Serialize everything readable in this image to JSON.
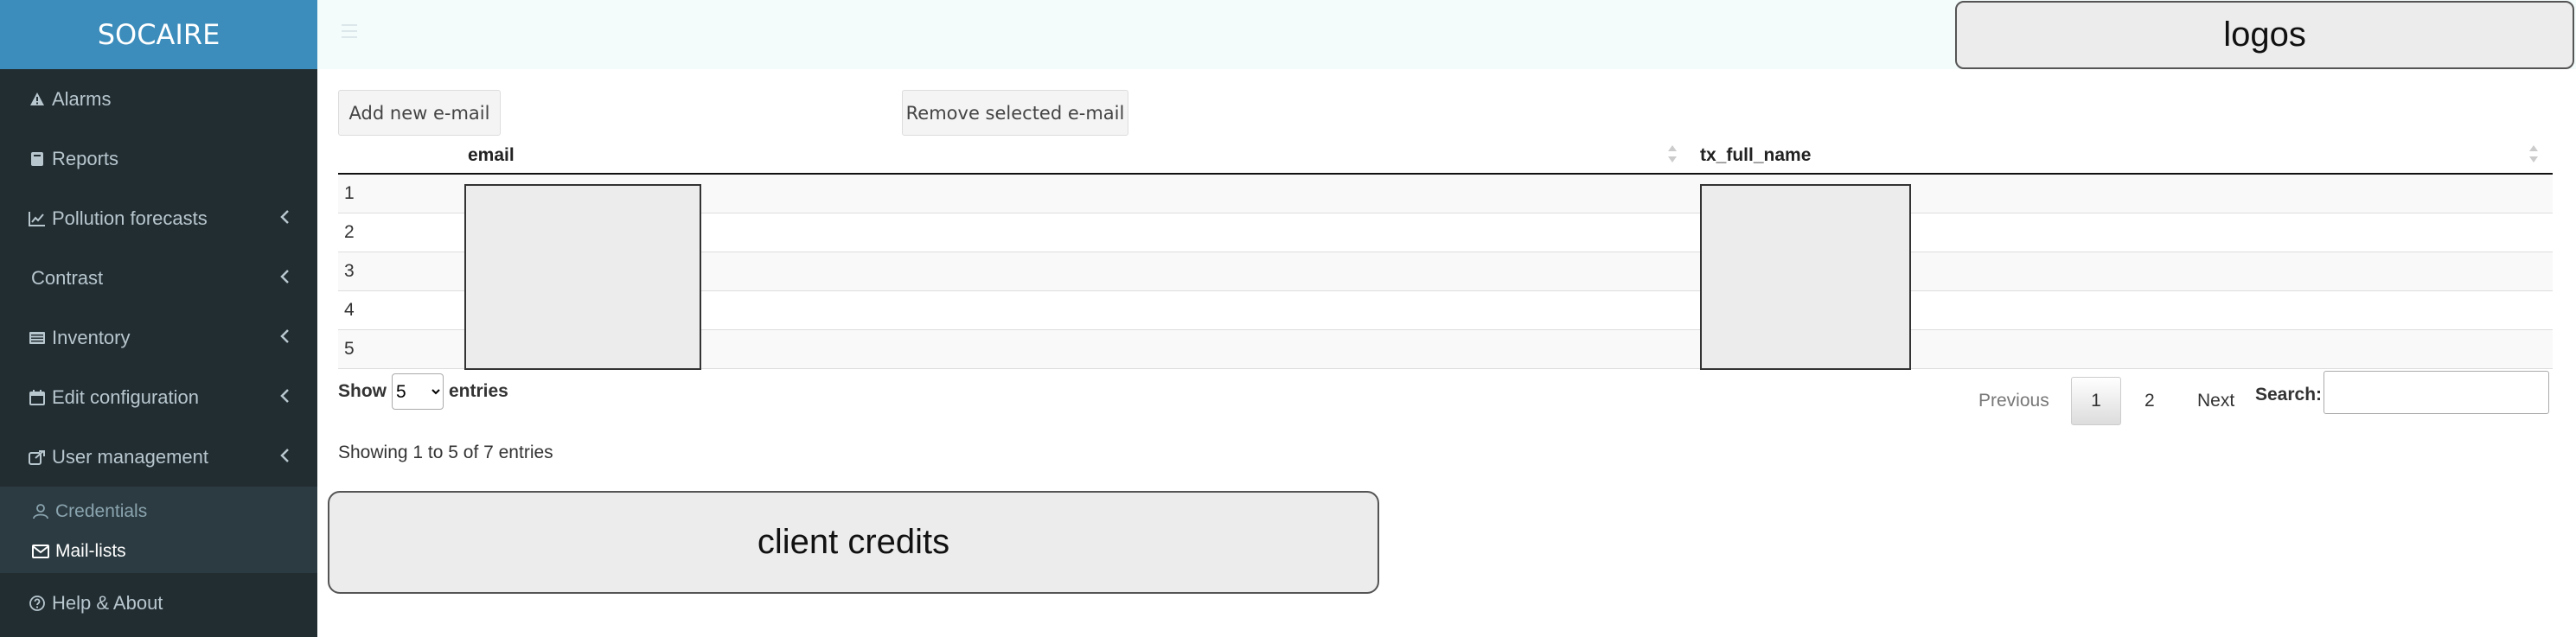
{
  "sidebar": {
    "brand": "SOCAIRE",
    "items": [
      {
        "label": "Alarms",
        "icon": "warning-icon"
      },
      {
        "label": "Reports",
        "icon": "book-icon"
      },
      {
        "label": "Pollution forecasts",
        "icon": "line-chart-icon",
        "expandable": true
      },
      {
        "label": "Contrast",
        "icon": "",
        "expandable": true
      },
      {
        "label": "Inventory",
        "icon": "list-icon",
        "expandable": true
      },
      {
        "label": "Edit configuration",
        "icon": "calendar-icon",
        "expandable": true
      },
      {
        "label": "User management",
        "icon": "share-icon",
        "expandable": true,
        "open": true
      }
    ],
    "submenu": [
      {
        "label": "Credentials",
        "icon": "user-icon"
      },
      {
        "label": "Mail-lists",
        "icon": "envelope-icon",
        "active": true
      }
    ],
    "help": {
      "label": "Help & About",
      "icon": "question-icon"
    }
  },
  "header": {
    "logos_label": "logos"
  },
  "toolbar": {
    "add_label": "Add new e-mail",
    "remove_label": "Remove selected e-mail"
  },
  "table": {
    "columns": [
      "email",
      "tx_full_name"
    ],
    "rows": [
      "1",
      "2",
      "3",
      "4",
      "5"
    ]
  },
  "length_menu": {
    "show_label": "Show",
    "selected": "5",
    "entries_label": "entries"
  },
  "pagination": {
    "previous": "Previous",
    "pages": [
      "1",
      "2"
    ],
    "current": "1",
    "next": "Next"
  },
  "search": {
    "label": "Search:",
    "value": ""
  },
  "info": "Showing 1 to 5 of 7 entries",
  "footer": {
    "credits_label": "client credits"
  },
  "colors": {
    "sidebar_bg": "#222d32",
    "brand_bg": "#3c8dbc",
    "submenu_bg": "#2c3b41",
    "header_bg": "#f4fbfb"
  }
}
